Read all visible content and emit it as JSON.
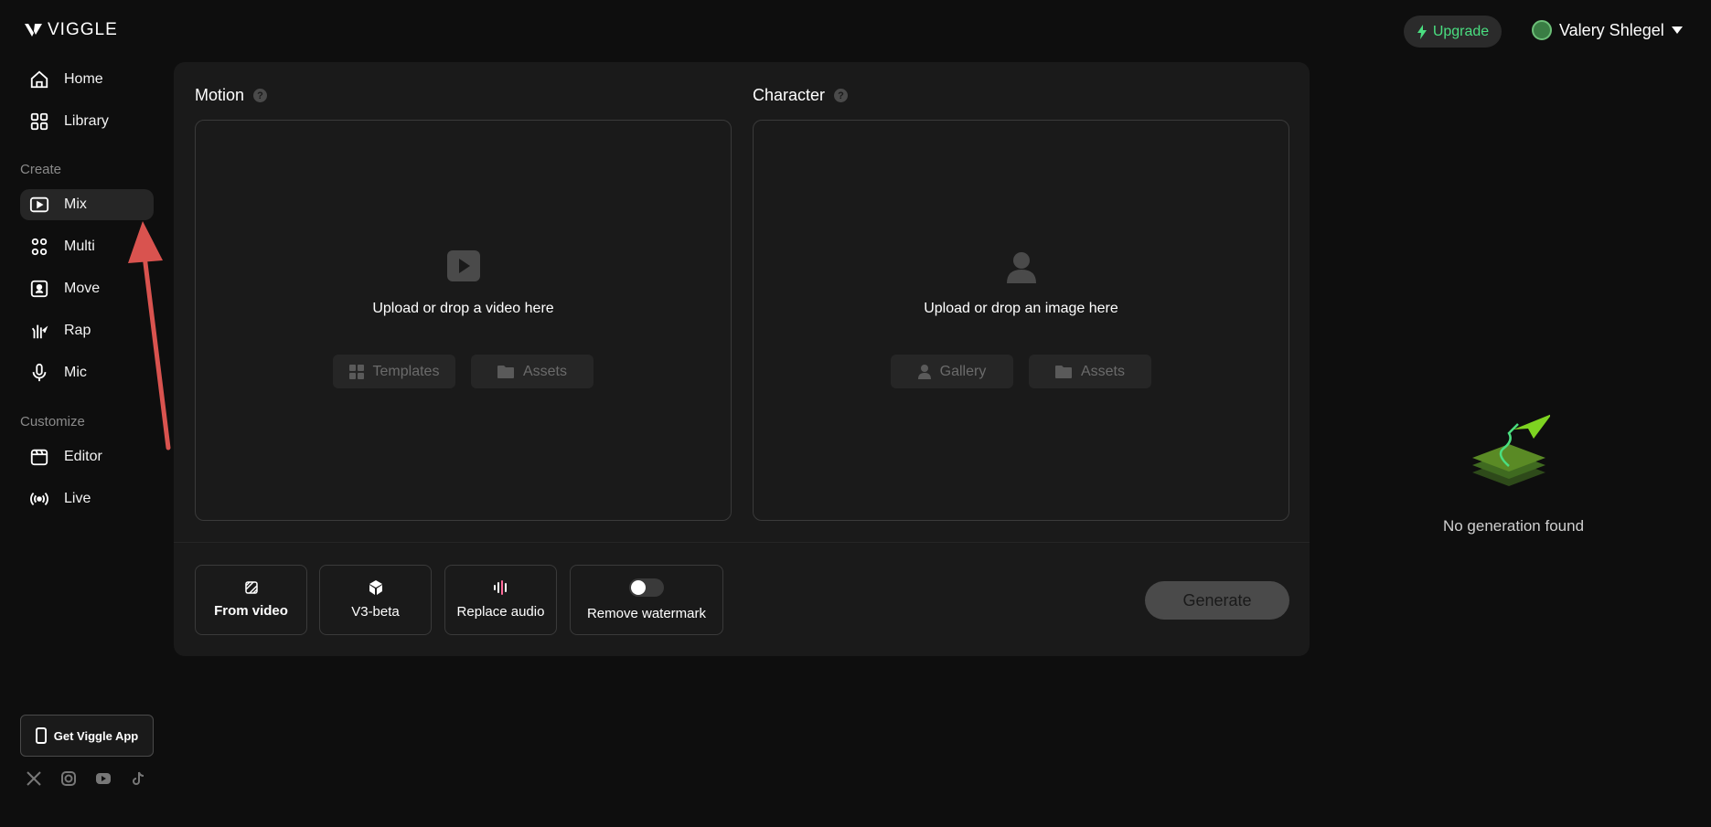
{
  "brand": {
    "name": "VIGGLE"
  },
  "sidebar": {
    "items_top": [
      {
        "label": "Home",
        "icon": "home-icon"
      },
      {
        "label": "Library",
        "icon": "library-icon"
      }
    ],
    "sections": [
      {
        "label": "Create"
      },
      {
        "label": "Customize"
      }
    ],
    "create_items": [
      {
        "label": "Mix",
        "icon": "mix-icon",
        "active": true
      },
      {
        "label": "Multi",
        "icon": "multi-icon"
      },
      {
        "label": "Move",
        "icon": "move-icon"
      },
      {
        "label": "Rap",
        "icon": "rap-icon"
      },
      {
        "label": "Mic",
        "icon": "mic-icon"
      }
    ],
    "customize_items": [
      {
        "label": "Editor",
        "icon": "editor-icon"
      },
      {
        "label": "Live",
        "icon": "live-icon"
      }
    ],
    "app_button": "Get Viggle App",
    "socials": [
      "x-icon",
      "instagram-icon",
      "youtube-icon",
      "tiktok-icon"
    ]
  },
  "header": {
    "upgrade_label": "Upgrade",
    "user_name": "Valery Shlegel"
  },
  "motion": {
    "title": "Motion",
    "drop_text": "Upload or drop a video here",
    "buttons": [
      "Templates",
      "Assets"
    ]
  },
  "character": {
    "title": "Character",
    "drop_text": "Upload or drop an image here",
    "buttons": [
      "Gallery",
      "Assets"
    ]
  },
  "options": {
    "from_video": "From video",
    "v3_beta": "V3-beta",
    "replace_audio": "Replace audio",
    "remove_watermark": "Remove watermark",
    "remove_watermark_on": false
  },
  "generate_label": "Generate",
  "empty_state": {
    "text": "No generation found"
  },
  "colors": {
    "accent_green": "#4ade80",
    "annotation_arrow": "#d9534f"
  }
}
